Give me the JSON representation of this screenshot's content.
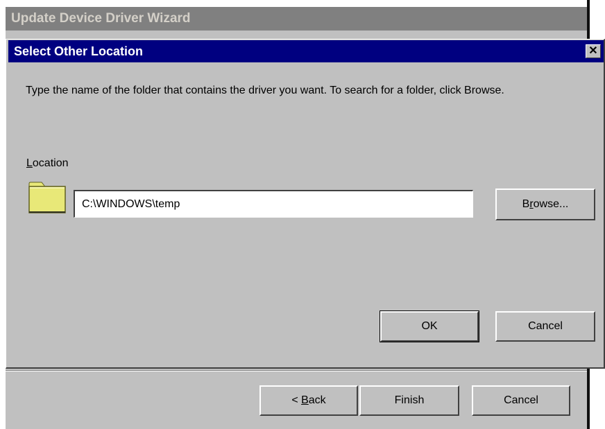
{
  "wizard": {
    "title": "Update Device Driver Wizard",
    "back_prefix": "< ",
    "back_accel": "B",
    "back_rest": "ack",
    "finish_label": "Finish",
    "cancel_label": "Cancel"
  },
  "dialog": {
    "title": "Select Other Location",
    "close_glyph": "✕",
    "instructions": "Type the name of the folder that contains the driver you want. To search for a folder, click Browse.",
    "location_label_accel": "L",
    "location_label_rest": "ocation",
    "location_value": "C:\\WINDOWS\\temp",
    "browse_pre": "B",
    "browse_accel": "r",
    "browse_rest": "owse...",
    "ok_label": "OK",
    "cancel_label": "Cancel",
    "folder_icon": "folder-icon"
  },
  "colors": {
    "title_active": "#000080",
    "title_inactive": "#808080",
    "face": "#c0c0c0",
    "folder_yellow": "#e8e878"
  }
}
